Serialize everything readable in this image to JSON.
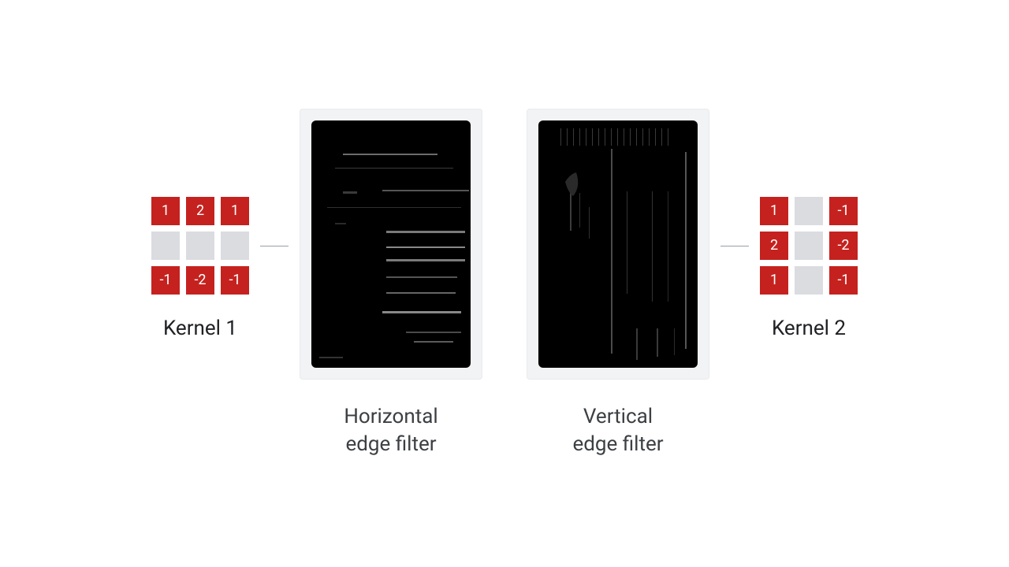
{
  "kernel1": {
    "label": "Kernel 1",
    "cells": [
      {
        "v": "1",
        "c": "red"
      },
      {
        "v": "2",
        "c": "red"
      },
      {
        "v": "1",
        "c": "red"
      },
      {
        "v": "",
        "c": "gray"
      },
      {
        "v": "",
        "c": "gray"
      },
      {
        "v": "",
        "c": "gray"
      },
      {
        "v": "-1",
        "c": "red"
      },
      {
        "v": "-2",
        "c": "red"
      },
      {
        "v": "-1",
        "c": "red"
      }
    ]
  },
  "kernel2": {
    "label": "Kernel 2",
    "cells": [
      {
        "v": "1",
        "c": "red"
      },
      {
        "v": "",
        "c": "gray"
      },
      {
        "v": "-1",
        "c": "red"
      },
      {
        "v": "2",
        "c": "red"
      },
      {
        "v": "",
        "c": "gray"
      },
      {
        "v": "-2",
        "c": "red"
      },
      {
        "v": "1",
        "c": "red"
      },
      {
        "v": "",
        "c": "gray"
      },
      {
        "v": "-1",
        "c": "red"
      }
    ]
  },
  "image1": {
    "label": "Horizontal\nedge filter"
  },
  "image2": {
    "label": "Vertical\nedge filter"
  }
}
